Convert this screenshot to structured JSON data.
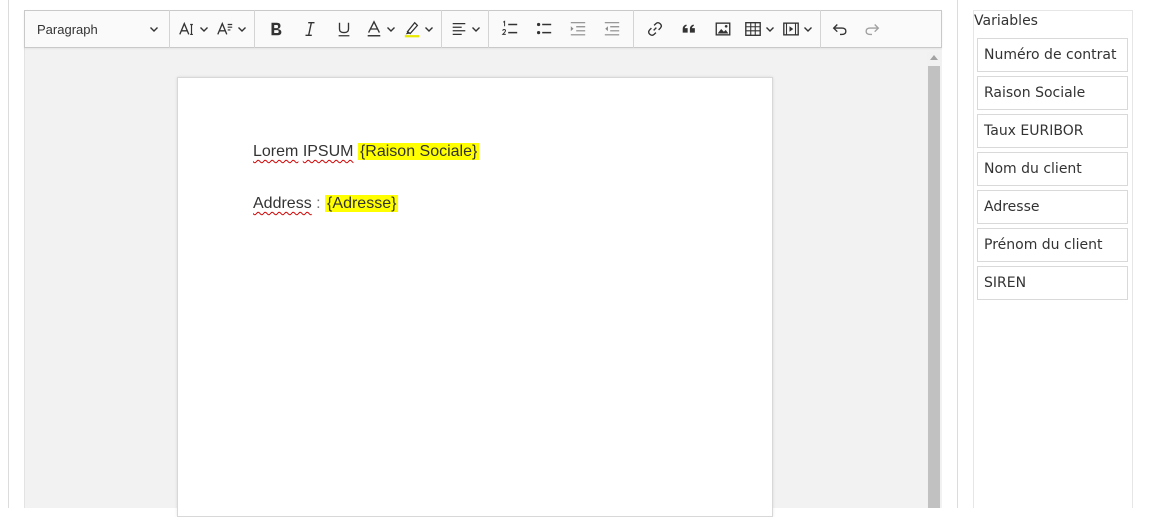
{
  "toolbar": {
    "paragraph_label": "Paragraph",
    "icons": [
      "font-size-icon",
      "font-family-icon",
      "bold-icon",
      "italic-icon",
      "underline-icon",
      "font-color-icon",
      "highlight-icon",
      "align-icon",
      "numbered-list-icon",
      "bulleted-list-icon",
      "indent-icon",
      "outdent-icon",
      "link-icon",
      "blockquote-icon",
      "image-icon",
      "table-icon",
      "media-icon",
      "undo-icon",
      "redo-icon"
    ]
  },
  "document": {
    "line1": {
      "w1": "Lorem",
      "w2": "IPSUM",
      "var": "{Raison Sociale}"
    },
    "line2": {
      "label": "Address",
      "sep": " : ",
      "var": "{Adresse}"
    }
  },
  "sidebar": {
    "title": "Variables",
    "items": [
      {
        "label": "Numéro de contrat"
      },
      {
        "label": "Raison Sociale"
      },
      {
        "label": "Taux EURIBOR"
      },
      {
        "label": "Nom du client"
      },
      {
        "label": "Adresse"
      },
      {
        "label": "Prénom du client"
      },
      {
        "label": "SIREN"
      }
    ]
  },
  "colors": {
    "highlight": "#ffff00",
    "spellcheck": "#d00000",
    "toolbar_bg": "#fafafa",
    "canvas_bg": "#f2f2f2"
  }
}
